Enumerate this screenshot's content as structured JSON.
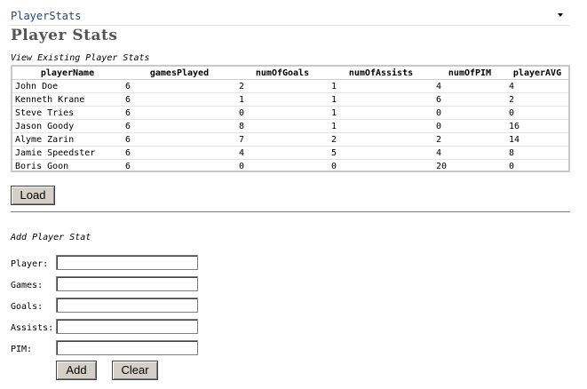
{
  "header": {
    "app_name": "PlayerStats",
    "menu_icon": "caret-down-icon"
  },
  "page": {
    "title": "Player Stats"
  },
  "view_section": {
    "caption": "View Existing Player Stats",
    "columns": [
      "playerName",
      "gamesPlayed",
      "numOfGoals",
      "numOfAssists",
      "numOfPIM",
      "playerAVG"
    ],
    "rows": [
      [
        "John Doe",
        "6",
        "2",
        "1",
        "4",
        "4"
      ],
      [
        "Kenneth Krane",
        "6",
        "1",
        "1",
        "6",
        "2"
      ],
      [
        "Steve Tries",
        "6",
        "0",
        "1",
        "0",
        "0"
      ],
      [
        "Jason Goody",
        "6",
        "8",
        "1",
        "0",
        "16"
      ],
      [
        "Alyme Zarin",
        "6",
        "7",
        "2",
        "2",
        "14"
      ],
      [
        "Jamie Speedster",
        "6",
        "4",
        "5",
        "4",
        "8"
      ],
      [
        "Boris Goon",
        "6",
        "0",
        "0",
        "20",
        "0"
      ]
    ],
    "load_label": "Load"
  },
  "add_section": {
    "caption": "Add Player Stat",
    "fields": [
      {
        "label": "Player:",
        "value": ""
      },
      {
        "label": "Games:",
        "value": ""
      },
      {
        "label": "Goals:",
        "value": ""
      },
      {
        "label": "Assists:",
        "value": ""
      },
      {
        "label": "PIM:",
        "value": ""
      }
    ],
    "add_label": "Add",
    "clear_label": "Clear"
  }
}
